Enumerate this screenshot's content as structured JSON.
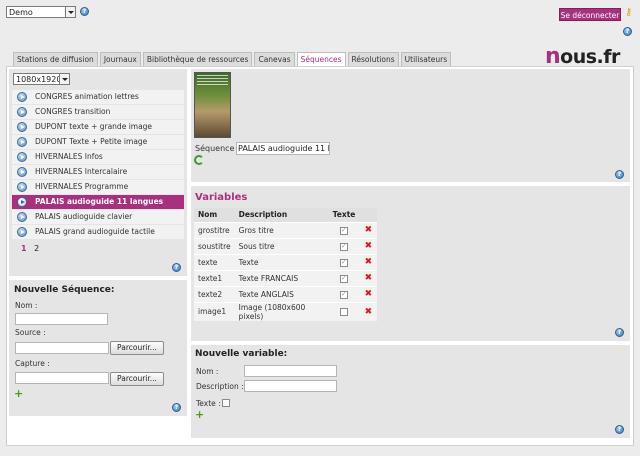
{
  "topbar": {
    "account_select": "Demo",
    "logout_label": "Se déconnecter"
  },
  "tabs": [
    {
      "label": "Stations de diffusion"
    },
    {
      "label": "Journaux"
    },
    {
      "label": "Bibliothèque de ressources"
    },
    {
      "label": "Canevas"
    },
    {
      "label": "Séquences"
    },
    {
      "label": "Résolutions"
    },
    {
      "label": "Utilisateurs"
    }
  ],
  "logo": {
    "first": "n",
    "rest": "ous.fr"
  },
  "sequences": {
    "resolution_select": "1080x1920",
    "items": [
      {
        "label": "CONGRES animation lettres"
      },
      {
        "label": "CONGRES transition"
      },
      {
        "label": "DUPONT texte + grande image"
      },
      {
        "label": "DUPONT Texte + Petite image"
      },
      {
        "label": "HIVERNALES Infos"
      },
      {
        "label": "HIVERNALES Intercalaire"
      },
      {
        "label": "HIVERNALES Programme"
      },
      {
        "label": "PALAIS audioguide 11 langues"
      },
      {
        "label": "PALAIS audioguide clavier"
      },
      {
        "label": "PALAIS grand audioguide tactile"
      }
    ],
    "selected_index": 7,
    "pages": [
      "1",
      "2"
    ]
  },
  "new_sequence": {
    "title": "Nouvelle Séquence:",
    "name_label": "Nom :",
    "source_label": "Source :",
    "capture_label": "Capture :",
    "browse_label": "Parcourir..."
  },
  "preview": {
    "sequence_label": "Séquence :",
    "sequence_value": "PALAIS audioguide 11 la"
  },
  "variables": {
    "title": "Variables",
    "headers": [
      "Nom",
      "Description",
      "Texte"
    ],
    "rows": [
      {
        "nom": "grostitre",
        "description": "Gros titre",
        "texte": true
      },
      {
        "nom": "soustitre",
        "description": "Sous titre",
        "texte": true
      },
      {
        "nom": "texte",
        "description": "Texte",
        "texte": true
      },
      {
        "nom": "texte1",
        "description": "Texte FRANCAIS",
        "texte": true
      },
      {
        "nom": "texte2",
        "description": "Texte ANGLAIS",
        "texte": true
      },
      {
        "nom": "image1",
        "description": "Image (1080x600 pixels)",
        "texte": false
      }
    ]
  },
  "new_variable": {
    "title": "Nouvelle variable:",
    "name_label": "Nom :",
    "description_label": "Description :",
    "texte_label": "Texte :"
  },
  "colors": {
    "accent": "#a8307f",
    "panel": "#e5e5e5"
  }
}
